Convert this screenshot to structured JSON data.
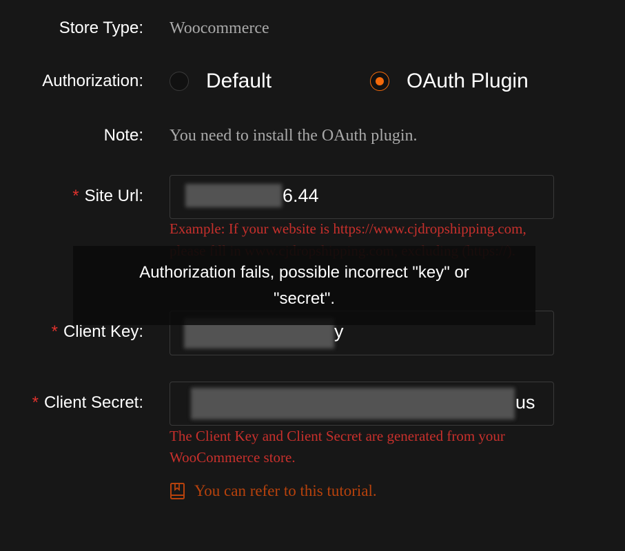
{
  "store_type": {
    "label": "Store Type:",
    "value": "Woocommerce"
  },
  "authorization": {
    "label": "Authorization:",
    "options": [
      {
        "label": "Default",
        "checked": false
      },
      {
        "label": "OAuth Plugin",
        "checked": true
      }
    ]
  },
  "note": {
    "label": "Note:",
    "value": "You need to install the OAuth plugin."
  },
  "site_url": {
    "required_mark": "*",
    "label": "Site Url:",
    "value_visible": "6.44",
    "hint_line1": "Example: If your website is https://www.cjdropshipping.com,",
    "hint_line2": "please fill in www.cjdropshipping.com, excluding (https://)."
  },
  "client_key": {
    "required_mark": "*",
    "label": "Client Key:",
    "value_visible": "y"
  },
  "client_secret": {
    "required_mark": "*",
    "label": "Client Secret:",
    "value_visible": "us",
    "hint_line1": "The Client Key and Client Secret are generated from your",
    "hint_line2": "WooCommerce store."
  },
  "tutorial": {
    "icon": "book-icon",
    "text": "You can refer to this tutorial."
  },
  "toast": {
    "line1": "Authorization fails, possible incorrect \"key\" or",
    "line2": "\"secret\"."
  },
  "colors": {
    "accent": "#f46a0b",
    "error": "#c8302c",
    "background": "#171717"
  }
}
